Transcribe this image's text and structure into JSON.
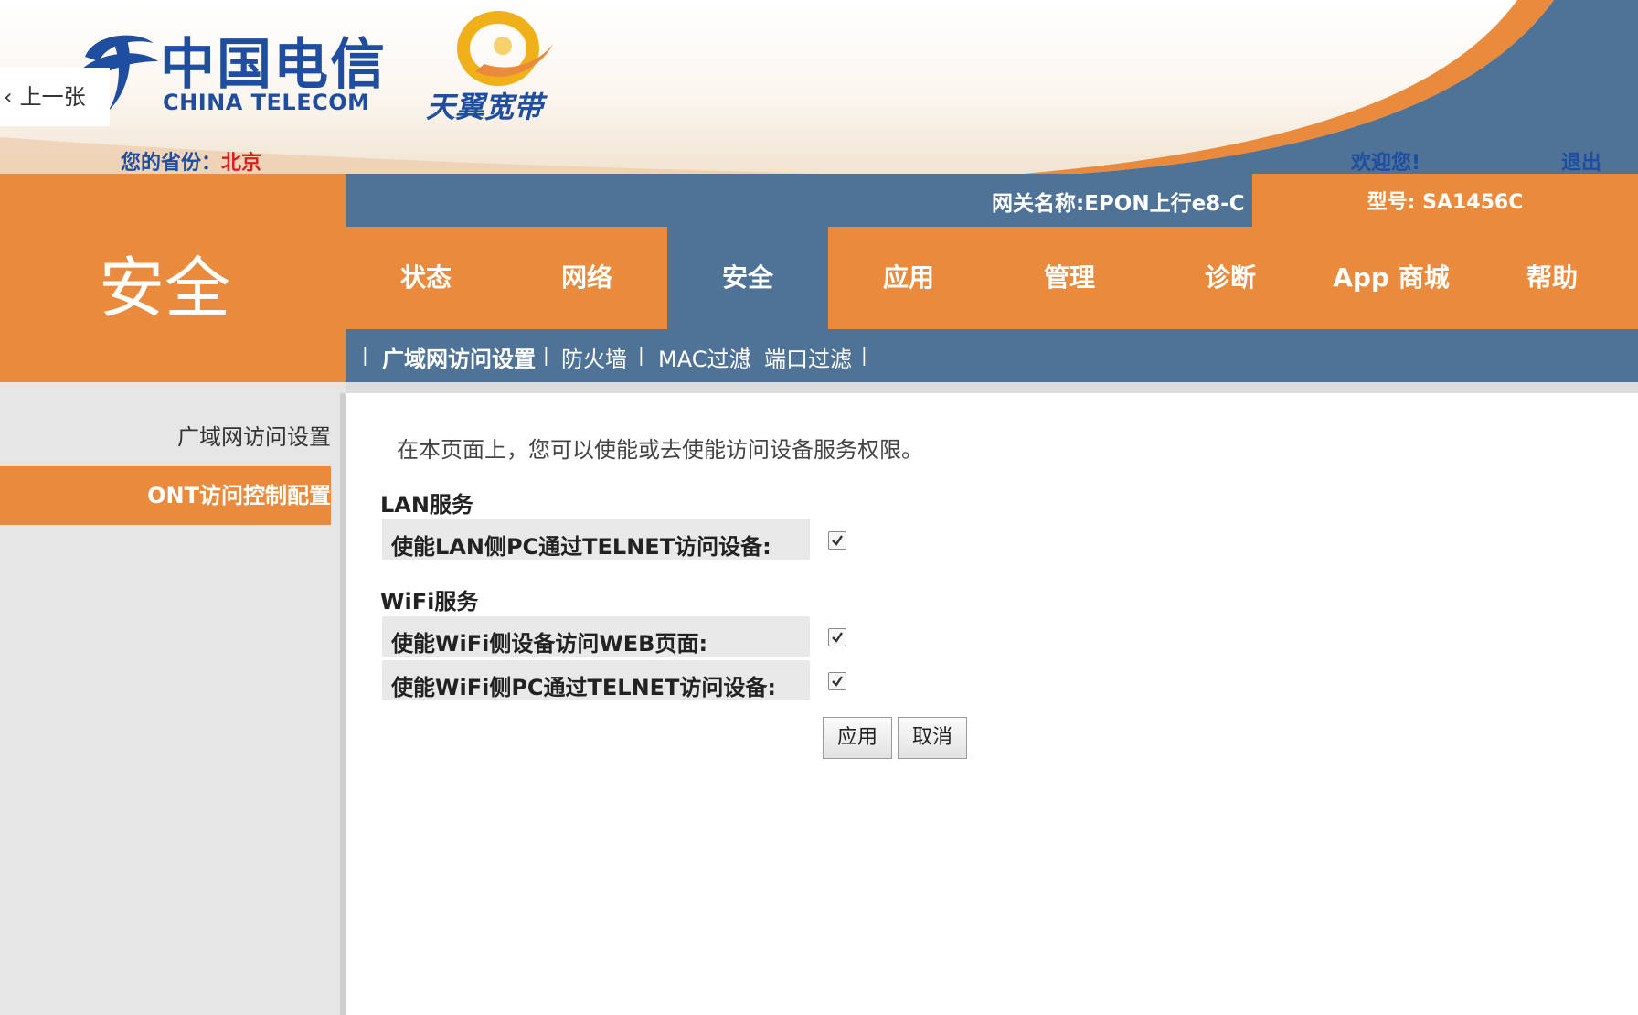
{
  "header": {
    "logo_cn": "中国电信",
    "logo_en": "CHINA TELECOM",
    "brand": "天翼宽带",
    "prev_label": "上一张",
    "province_label": "您的省份：",
    "province_value": "北京",
    "welcome": "欢迎您!",
    "logout": "退出"
  },
  "section_title": "安全",
  "gateway": {
    "name": "网关名称:EPON上行e8-C",
    "model": "型号: SA1456C"
  },
  "nav": {
    "items": [
      {
        "label": "状态"
      },
      {
        "label": "网络"
      },
      {
        "label": "安全"
      },
      {
        "label": "应用"
      },
      {
        "label": "管理"
      },
      {
        "label": "诊断"
      },
      {
        "label": "App 商城"
      },
      {
        "label": "帮助"
      }
    ],
    "active_index": 2
  },
  "subnav": {
    "items": [
      {
        "label": "广域网访问设置"
      },
      {
        "label": "防火墙"
      },
      {
        "label": "MAC过滤"
      },
      {
        "label": "端口过滤"
      }
    ],
    "active_index": 0
  },
  "sidebar": {
    "items": [
      {
        "label": "广域网访问设置"
      },
      {
        "label": "ONT访问控制配置"
      }
    ],
    "active_index": 1
  },
  "content": {
    "intro": "在本页面上，您可以使能或去使能访问设备服务权限。",
    "lan": {
      "title": "LAN服务",
      "telnet_label": "使能LAN侧PC通过TELNET访问设备:",
      "telnet_checked": true
    },
    "wifi": {
      "title": "WiFi服务",
      "web_label": "使能WiFi侧设备访问WEB页面:",
      "web_checked": true,
      "telnet_label": "使能WiFi侧PC通过TELNET访问设备:",
      "telnet_checked": true
    },
    "apply_label": "应用",
    "cancel_label": "取消"
  },
  "colors": {
    "orange": "#e98a3c",
    "blue": "#4f7297",
    "logo_blue": "#1f4ea1",
    "red": "#d6201f"
  }
}
